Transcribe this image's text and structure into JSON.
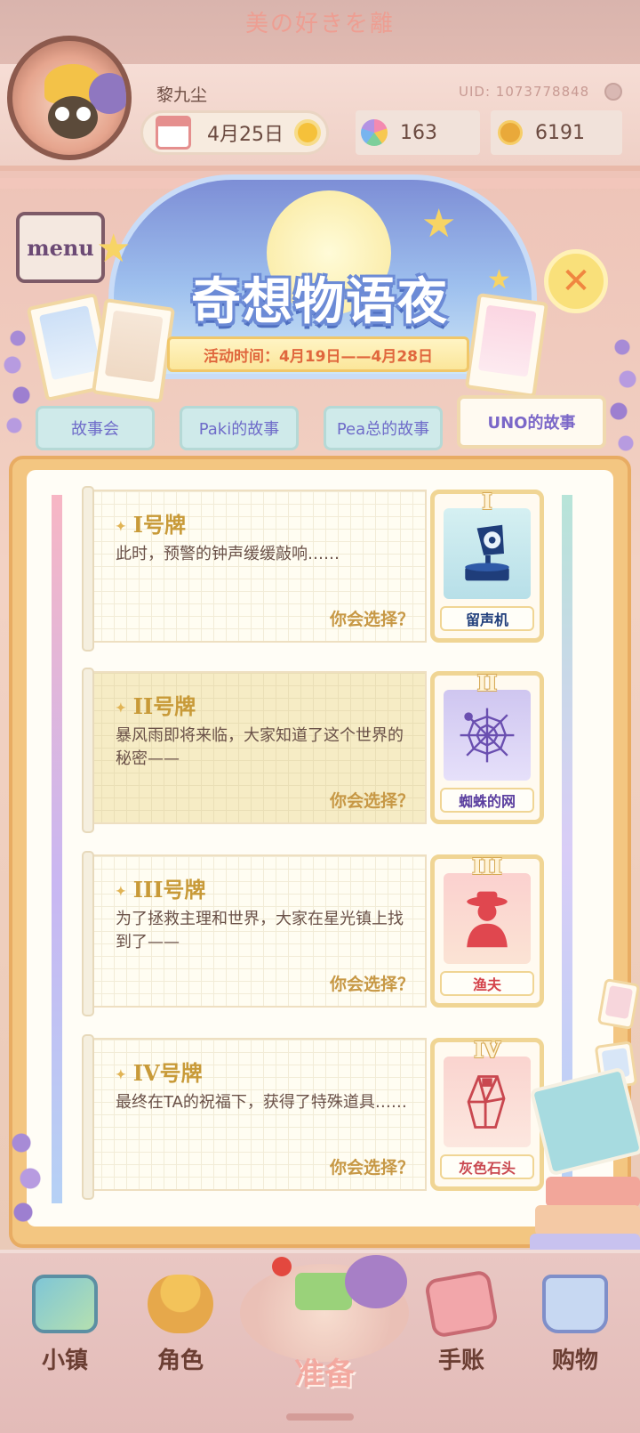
{
  "banner": {
    "text": "美の好きを離"
  },
  "player": {
    "name": "黎九尘",
    "uid": "UID: 1073778848",
    "date": "4月25日",
    "gems": "163",
    "coins": "6191"
  },
  "deco": {
    "menu_sign": "menu"
  },
  "event": {
    "title": "奇想物语夜",
    "time": "活动时间：4月19日——4月28日",
    "close_symbol": "✕"
  },
  "tabs": [
    {
      "label": "故事会",
      "active": false
    },
    {
      "label": "Paki的故事",
      "active": false
    },
    {
      "label": "Pea总的故事",
      "active": false
    },
    {
      "label": "UNO的故事",
      "active": true
    }
  ],
  "entries": [
    {
      "title": "I号牌",
      "desc": "此时，预警的钟声缓缓敲响……",
      "choose": "你会选择？",
      "card_num": "I",
      "card_label": "留声机"
    },
    {
      "title": "II号牌",
      "desc": "暴风雨即将来临，大家知道了这个世界的秘密——",
      "choose": "你会选择？",
      "card_num": "II",
      "card_label": "蜘蛛的网"
    },
    {
      "title": "III号牌",
      "desc": "为了拯救主理和世界，大家在星光镇上找到了——",
      "choose": "你会选择？",
      "card_num": "III",
      "card_label": "渔夫"
    },
    {
      "title": "IV号牌",
      "desc": "最终在TA的祝福下，获得了特殊道具……",
      "choose": "你会选择？",
      "card_num": "IV",
      "card_label": "灰色石头"
    }
  ],
  "nav": [
    {
      "label": "小镇",
      "icon": "map-icon"
    },
    {
      "label": "角色",
      "icon": "character-icon"
    },
    {
      "label": "准备",
      "icon": "picnic-basket-icon"
    },
    {
      "label": "手账",
      "icon": "journal-icon"
    },
    {
      "label": "购物",
      "icon": "shopping-bag-icon"
    }
  ]
}
